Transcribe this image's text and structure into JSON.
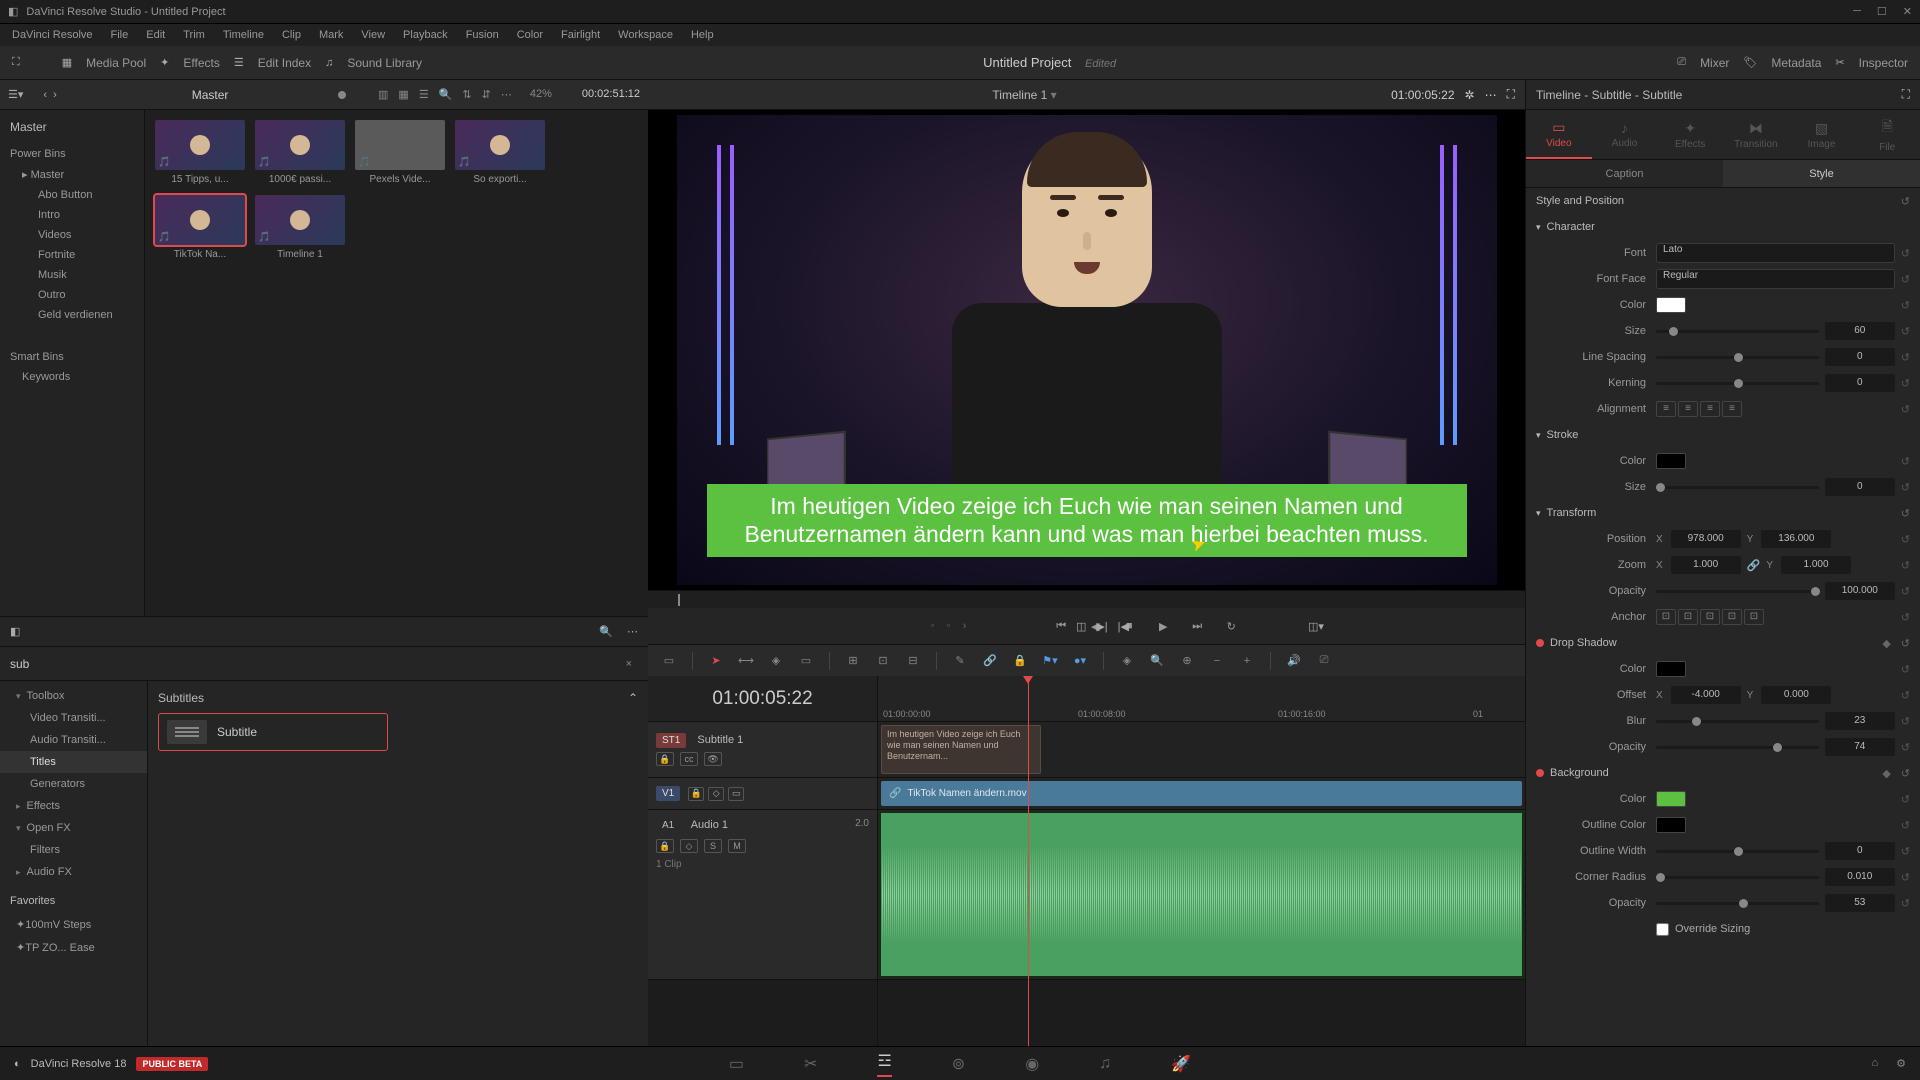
{
  "app": {
    "title": "DaVinci Resolve Studio - Untitled Project",
    "version": "DaVinci Resolve 18",
    "beta": "PUBLIC BETA"
  },
  "menu": [
    "DaVinci Resolve",
    "File",
    "Edit",
    "Trim",
    "Timeline",
    "Clip",
    "Mark",
    "View",
    "Playback",
    "Fusion",
    "Color",
    "Fairlight",
    "Workspace",
    "Help"
  ],
  "mainToolbar": {
    "mediaPool": "Media Pool",
    "effects": "Effects",
    "editIndex": "Edit Index",
    "soundLibrary": "Sound Library",
    "mixer": "Mixer",
    "metadata": "Metadata",
    "inspector": "Inspector"
  },
  "project": {
    "name": "Untitled Project",
    "status": "Edited"
  },
  "mediaHeader": {
    "master": "Master",
    "zoom": "42%",
    "tc": "00:02:51:12"
  },
  "bins": {
    "master": "Master",
    "powerBins": "Power Bins",
    "masterSub": "Master",
    "children": [
      "Abo Button",
      "Intro",
      "Videos",
      "Fortnite",
      "Musik",
      "Outro",
      "Geld verdienen"
    ],
    "smartBins": "Smart Bins",
    "keywords": "Keywords"
  },
  "clips": [
    {
      "name": "15 Tipps, u..."
    },
    {
      "name": "1000€ passi..."
    },
    {
      "name": "Pexels Vide..."
    },
    {
      "name": "So exporti..."
    },
    {
      "name": "TikTok Na...",
      "sel": true
    },
    {
      "name": "Timeline 1"
    }
  ],
  "fxSearch": {
    "value": "sub",
    "clear": "×"
  },
  "fxTree": {
    "toolbox": "Toolbox",
    "vt": "Video Transiti...",
    "at": "Audio Transiti...",
    "titles": "Titles",
    "gen": "Generators",
    "effects": "Effects",
    "openfx": "Open FX",
    "filters": "Filters",
    "audiofx": "Audio FX",
    "favorites": "Favorites",
    "fav1": "100mV Steps",
    "fav2": "TP ZO... Ease"
  },
  "fxContent": {
    "header": "Subtitles",
    "item": "Subtitle"
  },
  "viewer": {
    "timeline": "Timeline 1",
    "tc": "01:00:05:22",
    "subtitle": "Im heutigen Video zeige ich Euch wie man seinen Namen und Benutzernamen ändern kann und was man hierbei beachten muss."
  },
  "timeline": {
    "tc": "01:00:05:22",
    "ruler": [
      "01:00:00:00",
      "01:00:08:00",
      "01:00:16:00",
      "01"
    ],
    "st1": {
      "badge": "ST1",
      "name": "Subtitle 1"
    },
    "v1": {
      "badge": "V1"
    },
    "a1": {
      "badge": "A1",
      "name": "Audio 1",
      "ch": "2.0",
      "clips": "1 Clip"
    },
    "subClip": "Im heutigen Video zeige ich Euch wie man seinen Namen und Benutzernam...",
    "vidClip": "TikTok Namen ändern.mov"
  },
  "inspector": {
    "title": "Timeline - Subtitle - Subtitle",
    "tabs": {
      "video": "Video",
      "audio": "Audio",
      "effects": "Effects",
      "transition": "Transition",
      "image": "Image",
      "file": "File"
    },
    "subtabs": {
      "caption": "Caption",
      "style": "Style"
    },
    "stylePos": "Style and Position",
    "character": {
      "hdr": "Character",
      "font": "Font",
      "fontFace": "Font Face",
      "fontVal": "Lato",
      "faceVal": "Regular",
      "color": "Color",
      "size": "Size",
      "sizeVal": "60",
      "lineSpacing": "Line Spacing",
      "lsVal": "0",
      "kerning": "Kerning",
      "kernVal": "0",
      "alignment": "Alignment"
    },
    "stroke": {
      "hdr": "Stroke",
      "color": "Color",
      "size": "Size",
      "sizeVal": "0"
    },
    "transform": {
      "hdr": "Transform",
      "position": "Position",
      "posX": "978.000",
      "posY": "136.000",
      "zoom": "Zoom",
      "zoomX": "1.000",
      "zoomY": "1.000",
      "opacity": "Opacity",
      "opacVal": "100.000",
      "anchor": "Anchor"
    },
    "dropShadow": {
      "hdr": "Drop Shadow",
      "color": "Color",
      "offset": "Offset",
      "offX": "-4.000",
      "offY": "0.000",
      "blur": "Blur",
      "blurVal": "23",
      "opacity": "Opacity",
      "opacVal": "74"
    },
    "background": {
      "hdr": "Background",
      "color": "Color",
      "colorVal": "#5cc040",
      "outlineColor": "Outline Color",
      "outlineWidth": "Outline Width",
      "owVal": "0",
      "cornerRadius": "Corner Radius",
      "crVal": "0.010",
      "opacity": "Opacity",
      "opacVal": "53",
      "override": "Override Sizing"
    }
  }
}
